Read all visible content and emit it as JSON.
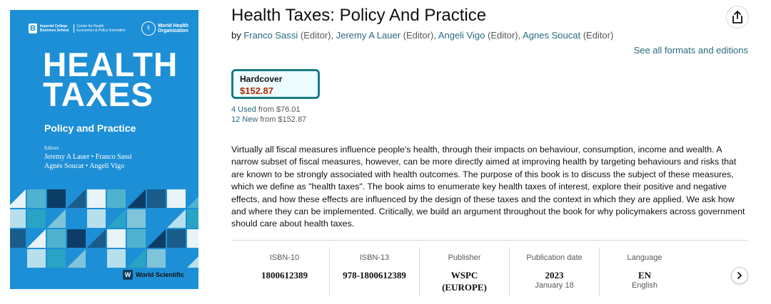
{
  "cover": {
    "imperial_line1": "Imperial College",
    "imperial_line2": "Business School",
    "centre_line1": "Centre for Health",
    "centre_line2": "Economics & Policy Innovation",
    "who_line1": "World Health",
    "who_line2": "Organization",
    "title_line1": "HEALTH",
    "title_line2": "TAXES",
    "subtitle": "Policy and Practice",
    "editors_label": "Editors",
    "editors_line1": "Jeremy A Lauer • Franco Sassi",
    "editors_line2": "Agnès Soucat • Angeli Vigo",
    "publisher_logo": "World Scientific"
  },
  "product": {
    "title": "Health Taxes: Policy And Practice",
    "by": "by",
    "authors": [
      {
        "name": "Franco Sassi",
        "role": "(Editor),"
      },
      {
        "name": "Jeremy A Lauer",
        "role": "(Editor),"
      },
      {
        "name": "Angeli Vigo",
        "role": "(Editor),"
      },
      {
        "name": "Agnes Soucat",
        "role": "(Editor)"
      }
    ],
    "see_all": "See all formats and editions",
    "format_label": "Hardcover",
    "format_price": "$152.87",
    "used_count": "4 Used",
    "used_from": "from $76.01",
    "new_count": "12 New",
    "new_from": "from $152.87",
    "description": "Virtually all fiscal measures influence people's health, through their impacts on behaviour, consumption, income and wealth. A narrow subset of fiscal measures, however, can be more directly aimed at improving health by targeting behaviours and risks that are known to be strongly associated with health outcomes. The purpose of this book is to discuss the subject of these measures, which we define as \"health taxes\". The book aims to enumerate key health taxes of interest, explore their positive and negative effects, and how these effects are influenced by the design of these taxes and the context in which they are applied. We ask how and where they can be implemented. Critically, we build an argument throughout the book for why policymakers across government should care about health taxes."
  },
  "attributes": [
    {
      "label": "ISBN-10",
      "value": "1800612389",
      "sub": ""
    },
    {
      "label": "ISBN-13",
      "value": "978-1800612389",
      "sub": ""
    },
    {
      "label": "Publisher",
      "value": "WSPC",
      "value2": "(EUROPE)",
      "sub": ""
    },
    {
      "label": "Publication date",
      "value": "2023",
      "sub": "January 18"
    },
    {
      "label": "Language",
      "value": "EN",
      "sub": "English"
    }
  ],
  "icons": {
    "share": "share-icon",
    "next": "chevron-right-icon"
  },
  "colors": {
    "link": "#2a6a80",
    "price": "#b12704",
    "selected_border": "#1a7a8a",
    "cover_blue": "#1d8fd6"
  }
}
